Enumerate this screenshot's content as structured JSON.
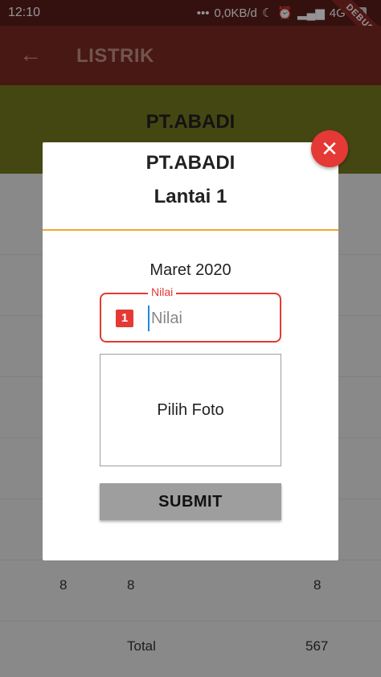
{
  "status_bar": {
    "time": "12:10",
    "network_speed": "0,0KB/d",
    "network_type": "4G",
    "battery": "93",
    "debug_label": "DEBUG"
  },
  "app_bar": {
    "title": "LISTRIK",
    "back_icon": "arrow-back-icon"
  },
  "header": {
    "company": "PT.ABADI"
  },
  "background_rows": [
    {
      "c1": "8",
      "c2": "8",
      "c3": "8"
    },
    {
      "label": "Total",
      "value": "567"
    }
  ],
  "dialog": {
    "company": "PT.ABADI",
    "floor": "Lantai 1",
    "period": "Maret 2020",
    "nilai_label": "Nilai",
    "nilai_placeholder": "Nilai",
    "nilai_badge": "1",
    "photo_label": "Pilih Foto",
    "submit_label": "SUBMIT",
    "close_icon": "close-icon"
  },
  "colors": {
    "app_bar": "#7a2a24",
    "header": "#787a1f",
    "accent_error": "#e53935",
    "divider": "#f0a830",
    "button": "#9e9e9e"
  }
}
